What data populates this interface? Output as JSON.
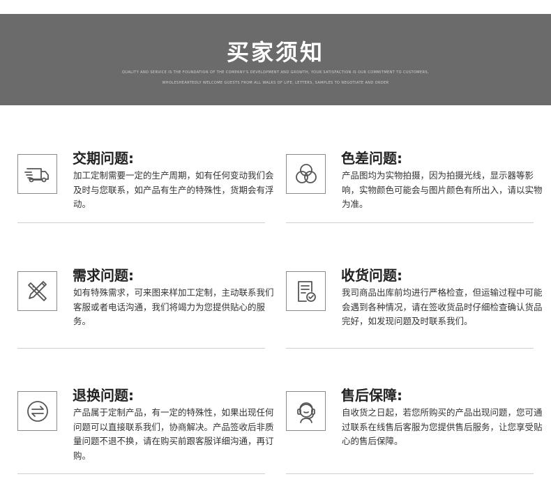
{
  "banner": {
    "title": "买家须知",
    "subtitle_line1": "QUALITY AND SERVICE IS THE FOUNDATION OF THE COMPANY'S DEVELOPMENT AND GROWTH, YOUR SATISFACTION IS OUR COMMITMENT TO CUSTOMERS,",
    "subtitle_line2": "WHOLESHEARTEDLY WELCOME GUESTS FROM ALL WALKS OF LIFE, LETTERS, SAMPLES TO NEGOTIATE AND ORDER"
  },
  "items": [
    {
      "title": "交期问题:",
      "text": "加工定制需要一定的生产周期，如有任何变动我们会及时与您联系，如产品有生产的特殊性，货期会有浮动。",
      "icon": "delivery-truck-icon"
    },
    {
      "title": "色差问题:",
      "text": "产品图均为实物拍摄，因为拍摄光线，显示器等影响，实物颜色可能会与图片颜色有所出入，请以实物为准。",
      "icon": "color-circles-icon"
    },
    {
      "title": "需求问题:",
      "text": "如有特殊需求，可来图来样加工定制，主动联系我们客服或者电话沟通，我们将竭力为您提供贴心的服务。",
      "icon": "pencil-ruler-icon"
    },
    {
      "title": "收货问题:",
      "text": "我司商品出库前均进行严格检查，但运输过程中可能会遇到各种情况，请在签收货品时仔细检查确认货品完好，如发现问题及时联系我们。",
      "icon": "checklist-icon"
    },
    {
      "title": "退换问题:",
      "text": "产品属于定制产品，有一定的特殊性，如果出现任何问题可以直接联系我们，协商解决。产品签收后非质量问题不退不换，请在购买前跟客服详细沟通，再订购。",
      "icon": "exchange-arrows-icon"
    },
    {
      "title": "售后保障:",
      "text": "自收货之日起，若您所购买的产品出现问题，您可通过联系在线售后客服为您提供售后服务，让您享受贴心的售后保障。",
      "icon": "customer-service-icon"
    }
  ]
}
